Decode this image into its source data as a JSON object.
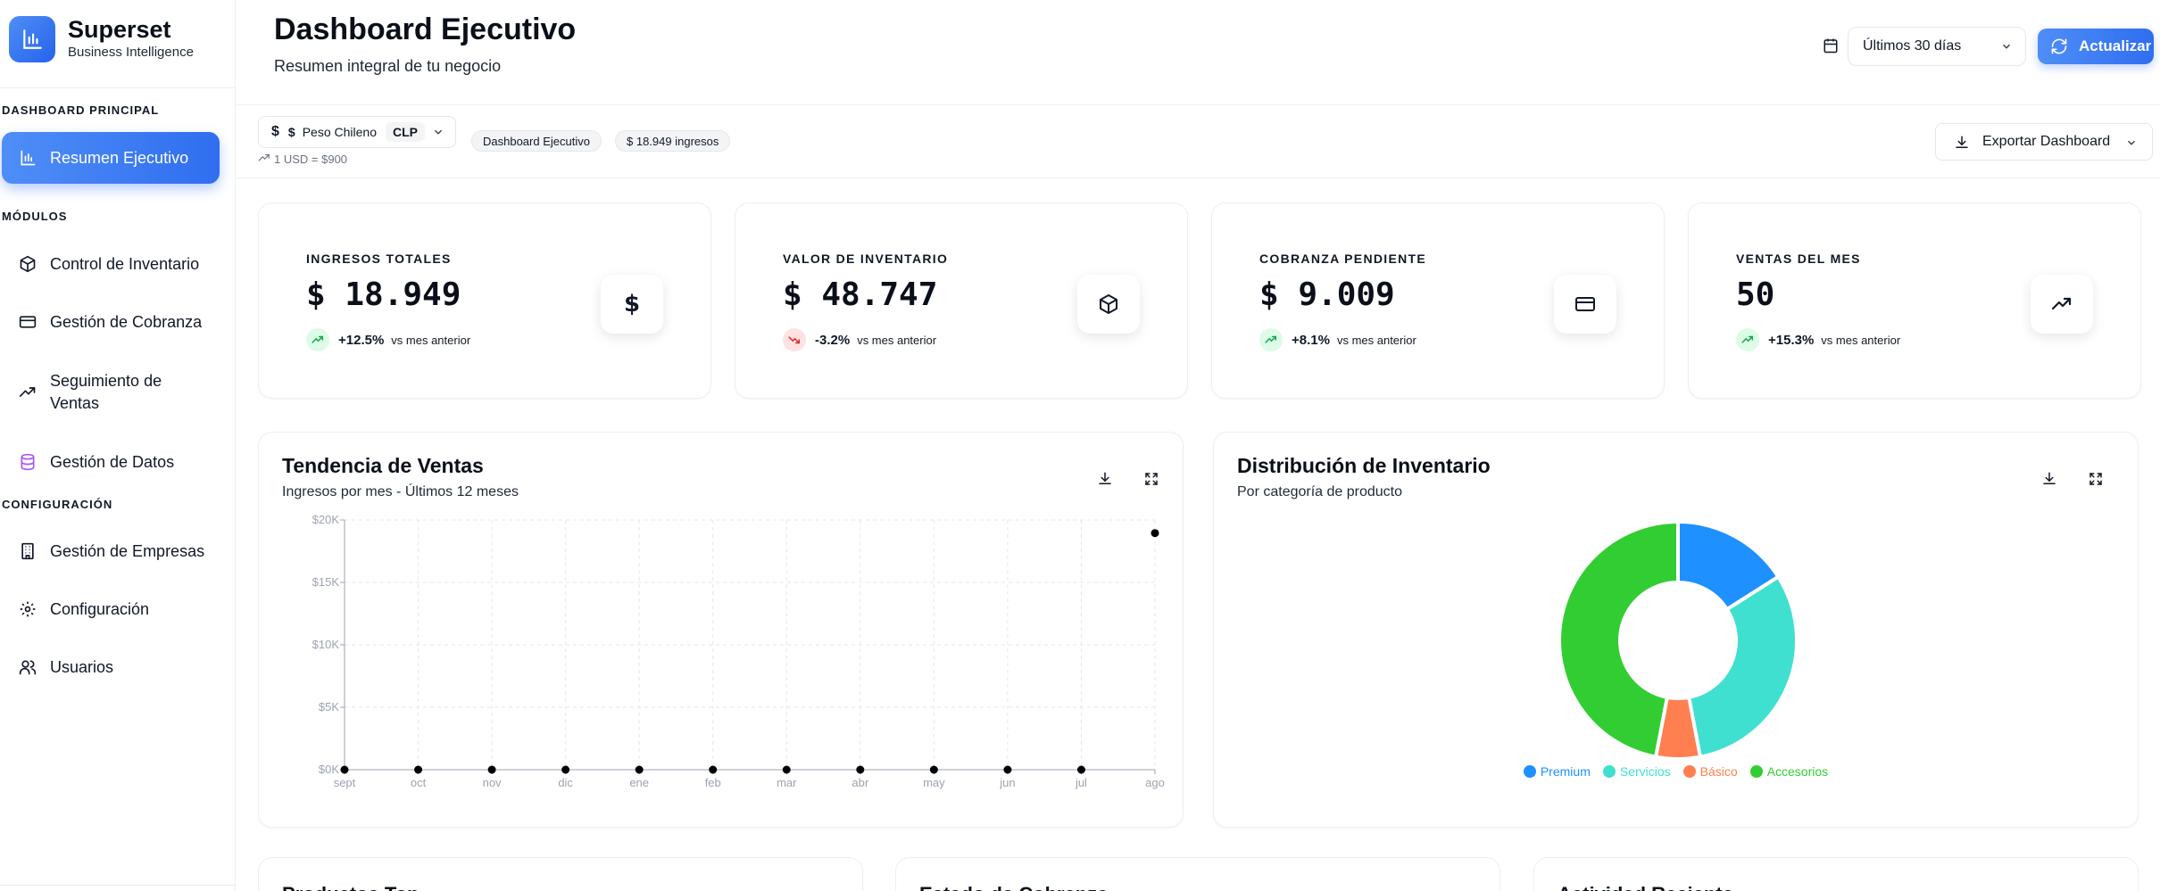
{
  "brand": {
    "title": "Superset",
    "subtitle": "Business Intelligence"
  },
  "sidebar": {
    "section_main": "DASHBOARD PRINCIPAL",
    "section_modules": "MÓDULOS",
    "section_config": "CONFIGURACIÓN",
    "items": [
      {
        "label": "Resumen Ejecutivo",
        "icon": "bar-chart-icon"
      },
      {
        "label": "Control de Inventario",
        "icon": "box-icon"
      },
      {
        "label": "Gestión de Cobranza",
        "icon": "credit-card-icon"
      },
      {
        "label": "Seguimiento de Ventas",
        "icon": "trending-up-icon"
      },
      {
        "label": "Gestión de Datos",
        "icon": "database-icon"
      },
      {
        "label": "Gestión de Empresas",
        "icon": "building-icon"
      },
      {
        "label": "Configuración",
        "icon": "gear-icon"
      },
      {
        "label": "Usuarios",
        "icon": "users-icon"
      }
    ]
  },
  "header": {
    "title": "Dashboard Ejecutivo",
    "subtitle": "Resumen integral de tu negocio",
    "period": "Últimos 30 días",
    "refresh_label": "Actualizar"
  },
  "toolbar": {
    "currency_symbol": "$",
    "currency_name": "Peso Chileno",
    "currency_code": "CLP",
    "rate": "1 USD = $900",
    "chip_dashboard": "Dashboard Ejecutivo",
    "chip_income": "$ 18.949 ingresos",
    "export_label": "Exportar Dashboard"
  },
  "kpis": [
    {
      "label": "INGRESOS TOTALES",
      "value": "$ 18.949",
      "delta": "+12.5%",
      "compare": "vs mes anterior",
      "trend": "up",
      "icon": "dollar-icon"
    },
    {
      "label": "VALOR DE INVENTARIO",
      "value": "$ 48.747",
      "delta": "-3.2%",
      "compare": "vs mes anterior",
      "trend": "down",
      "icon": "box-icon"
    },
    {
      "label": "COBRANZA PENDIENTE",
      "value": "$ 9.009",
      "delta": "+8.1%",
      "compare": "vs mes anterior",
      "trend": "up",
      "icon": "credit-card-icon"
    },
    {
      "label": "VENTAS DEL MES",
      "value": "50",
      "delta": "+15.3%",
      "compare": "vs mes anterior",
      "trend": "up",
      "icon": "trending-up-icon"
    }
  ],
  "cards": {
    "sales_title": "Tendencia de Ventas",
    "sales_subtitle": "Ingresos por mes - Últimos 12 meses",
    "inventory_title": "Distribución de Inventario",
    "inventory_subtitle": "Por categoría de producto"
  },
  "bottom_cards": [
    "Productos Top",
    "Estado de Cobranza",
    "Actividad Reciente"
  ],
  "chart_data": [
    {
      "type": "line",
      "title": "Tendencia de Ventas",
      "x": [
        "sept",
        "oct",
        "nov",
        "dic",
        "ene",
        "feb",
        "mar",
        "abr",
        "may",
        "jun",
        "jul",
        "ago"
      ],
      "series": [
        {
          "values": [
            0,
            0,
            0,
            0,
            0,
            0,
            0,
            0,
            0,
            0,
            0,
            18949
          ]
        }
      ],
      "yticks": [
        "$0K",
        "$5K",
        "$10K",
        "$15K",
        "$20K"
      ],
      "ylim": [
        0,
        20000
      ],
      "grid": true
    },
    {
      "type": "pie",
      "title": "Distribución de Inventario",
      "categories": [
        "Premium",
        "Servicios",
        "Básico",
        "Accesorios"
      ],
      "values": [
        16,
        31,
        6,
        47
      ],
      "colors": [
        "#1e90ff",
        "#40e0d0",
        "#ff7f50",
        "#32cd32"
      ],
      "legend": "bottom"
    }
  ]
}
